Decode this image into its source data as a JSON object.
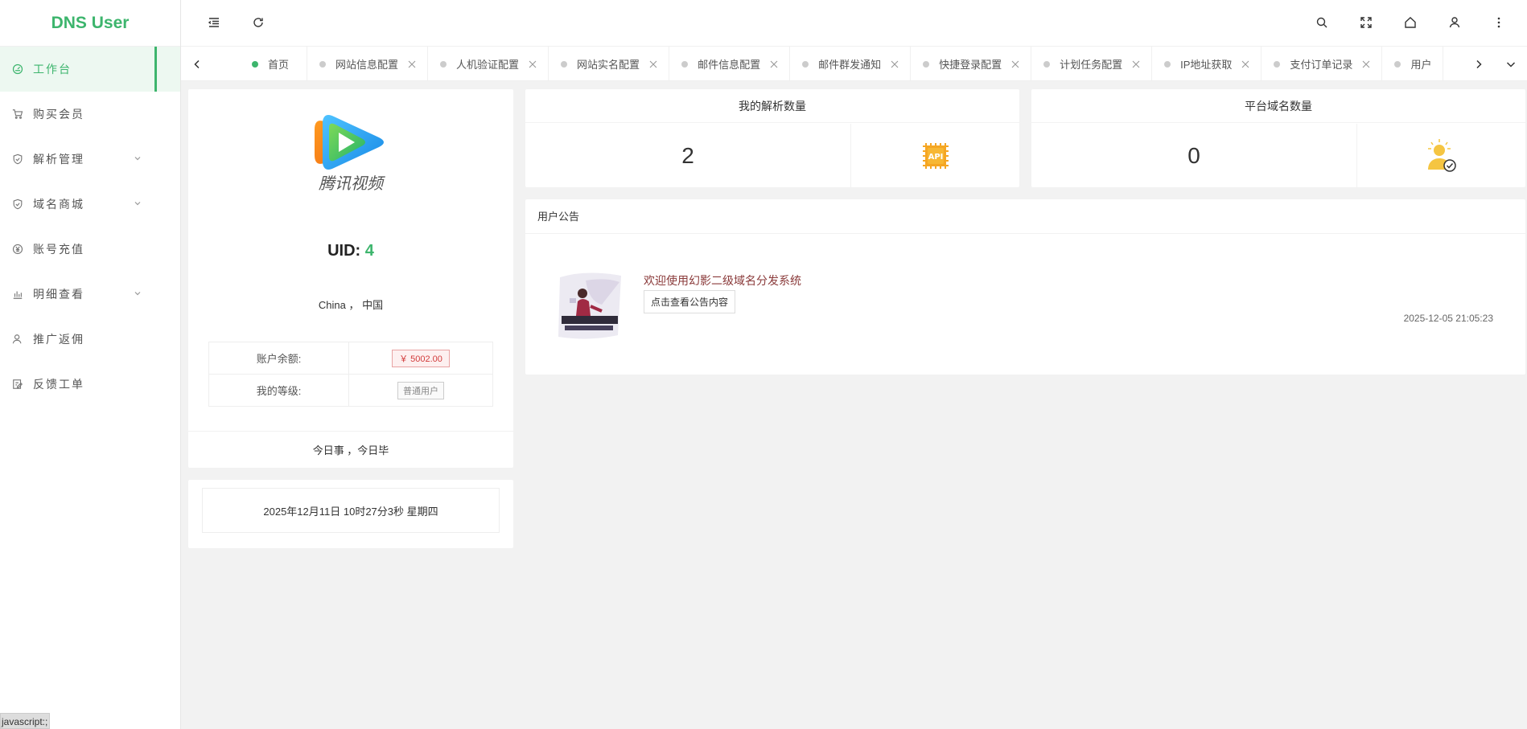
{
  "app": {
    "title": "DNS User"
  },
  "sidebar": {
    "items": [
      {
        "label": "工作台",
        "icon": "dashboard-icon",
        "active": true
      },
      {
        "label": "购买会员",
        "icon": "cart-icon"
      },
      {
        "label": "解析管理",
        "icon": "shield-icon",
        "expandable": true
      },
      {
        "label": "域名商城",
        "icon": "shield-icon",
        "expandable": true
      },
      {
        "label": "账号充值",
        "icon": "yen-icon"
      },
      {
        "label": "明细查看",
        "icon": "bar-chart-icon",
        "expandable": true
      },
      {
        "label": "推广返佣",
        "icon": "user-icon"
      },
      {
        "label": "反馈工单",
        "icon": "edit-icon"
      }
    ]
  },
  "tabs": [
    {
      "label": "首页",
      "active": true
    },
    {
      "label": "网站信息配置"
    },
    {
      "label": "人机验证配置"
    },
    {
      "label": "网站实名配置"
    },
    {
      "label": "邮件信息配置"
    },
    {
      "label": "邮件群发通知"
    },
    {
      "label": "快捷登录配置"
    },
    {
      "label": "计划任务配置"
    },
    {
      "label": "IP地址获取"
    },
    {
      "label": "支付订单记录"
    },
    {
      "label": "用户"
    }
  ],
  "profile": {
    "uid_label": "UID: ",
    "uid": "4",
    "location": "China ， 中国",
    "balance_label": "账户余额:",
    "balance_value": "￥ 5002.00",
    "level_label": "我的等级:",
    "level_value": "普通用户",
    "motto": "今日事 ，今日毕",
    "logo_text": "腾讯视频"
  },
  "clock": {
    "text": "2025年12月11日 10时27分3秒 星期四"
  },
  "stats": {
    "records": {
      "title": "我的解析数量",
      "value": "2",
      "icon_text": "API"
    },
    "domains": {
      "title": "平台域名数量",
      "value": "0"
    }
  },
  "notice": {
    "title": "用户公告",
    "headline": "欢迎使用幻影二级域名分发系统",
    "button": "点击查看公告内容",
    "date": "2025-12-05 21:05:23"
  },
  "status_bar": {
    "text": "javascript:;"
  },
  "colors": {
    "accent": "#3db56d",
    "money": "#d23b3b"
  }
}
